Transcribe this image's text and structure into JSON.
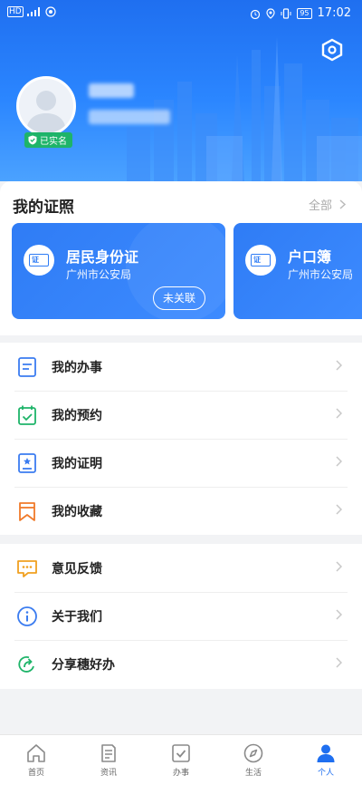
{
  "status_bar": {
    "network": "HD",
    "battery": "95",
    "time": "17:02"
  },
  "profile": {
    "verified_label": "已实名"
  },
  "certificates": {
    "title": "我的证照",
    "more_label": "全部",
    "cards": [
      {
        "icon_text": "证",
        "name": "居民身份证",
        "org": "广州市公安局",
        "action": "未关联"
      },
      {
        "icon_text": "证",
        "name": "户口簿",
        "org": "广州市公安局"
      }
    ]
  },
  "menu_group_1": [
    {
      "label": "我的办事",
      "icon": "document-list-icon",
      "color": "#3b7cf0"
    },
    {
      "label": "我的预约",
      "icon": "calendar-check-icon",
      "color": "#1eb469"
    },
    {
      "label": "我的证明",
      "icon": "certificate-icon",
      "color": "#3b7cf0"
    },
    {
      "label": "我的收藏",
      "icon": "bookmark-icon",
      "color": "#f07a2a"
    }
  ],
  "menu_group_2": [
    {
      "label": "意见反馈",
      "icon": "feedback-message-icon",
      "color": "#f0a020"
    },
    {
      "label": "关于我们",
      "icon": "info-icon",
      "color": "#3b7cf0"
    },
    {
      "label": "分享穗好办",
      "icon": "share-icon",
      "color": "#1eb469"
    }
  ],
  "tabbar": [
    {
      "label": "首页",
      "icon": "home-icon"
    },
    {
      "label": "资讯",
      "icon": "news-icon"
    },
    {
      "label": "办事",
      "icon": "tasks-icon"
    },
    {
      "label": "生活",
      "icon": "compass-icon"
    },
    {
      "label": "个人",
      "icon": "person-icon",
      "active": true
    }
  ],
  "colors": {
    "brand": "#1f6ff0",
    "verified": "#1eb469"
  }
}
